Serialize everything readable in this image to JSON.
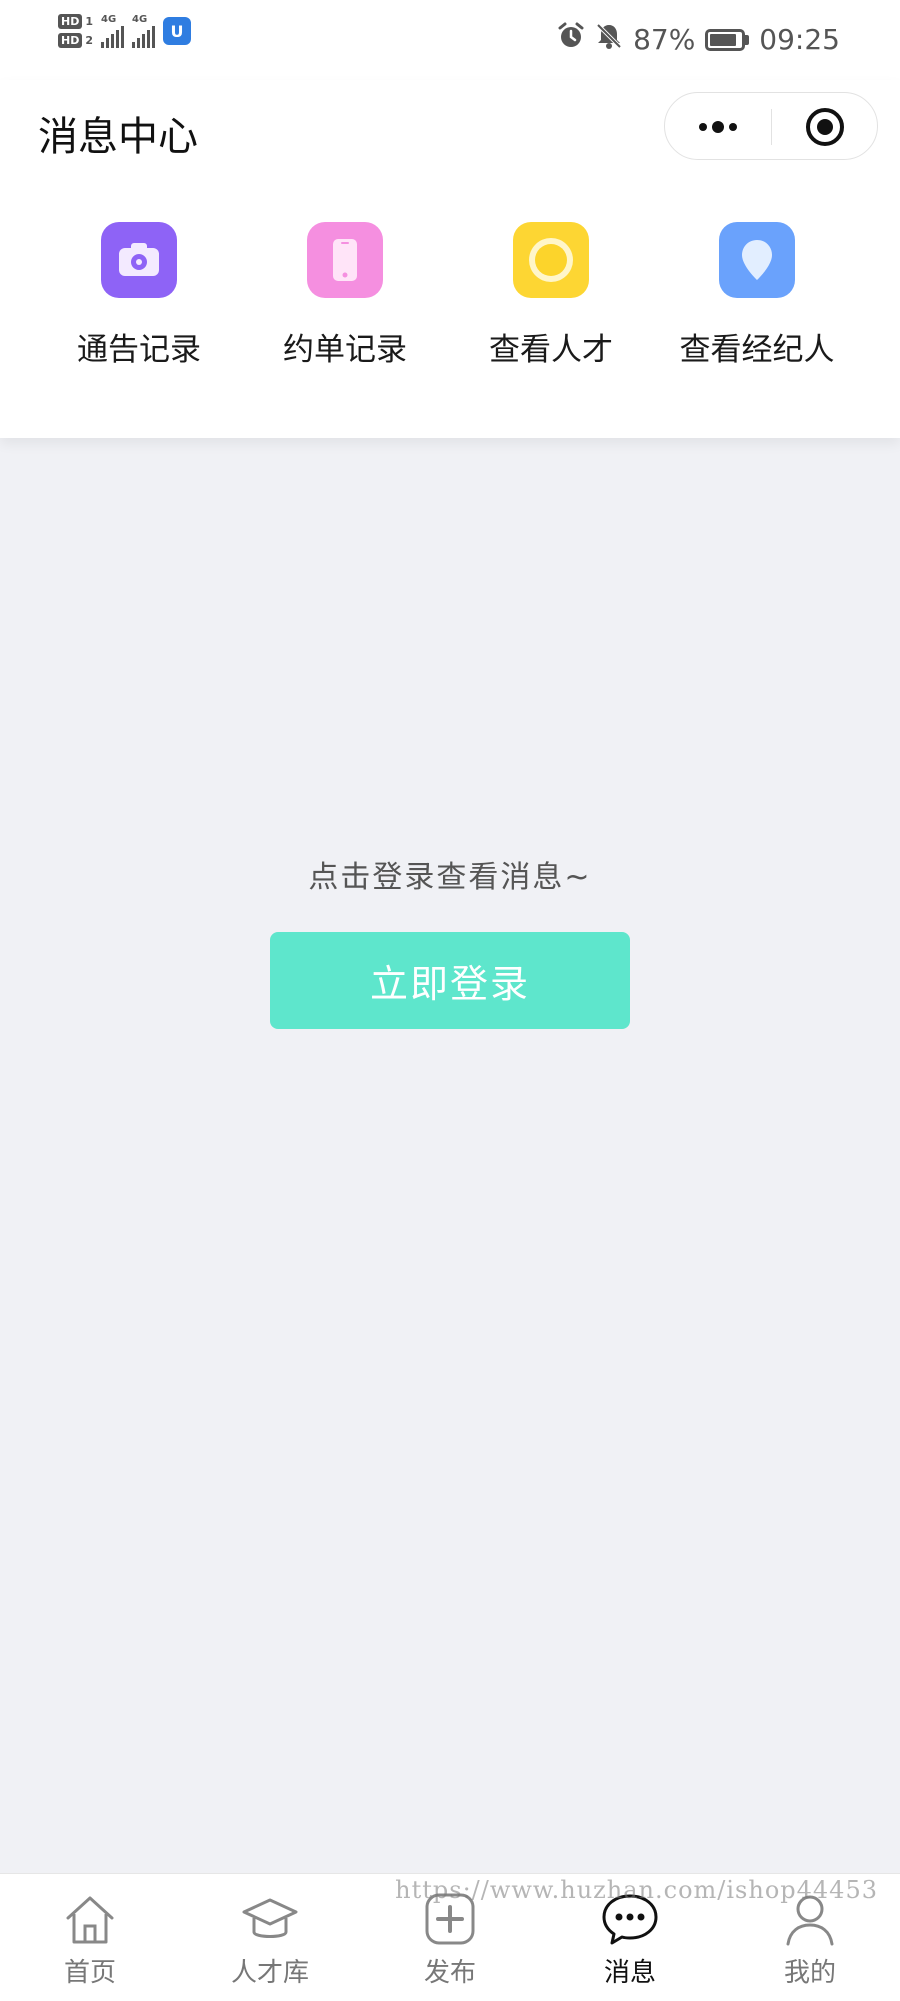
{
  "status_bar": {
    "sim1": "HD",
    "sim1_num": "1",
    "sim2": "HD",
    "sim2_num": "2",
    "network1": "4G",
    "network2": "4G",
    "app_badge": "U",
    "battery_percent": "87%",
    "battery_level": 0.87,
    "time": "09:25",
    "icons": [
      "alarm-icon",
      "mute-bell-icon",
      "battery-icon"
    ]
  },
  "header": {
    "title": "消息中心",
    "capsule": [
      "more-icon",
      "close-miniprogram-icon"
    ]
  },
  "quick_actions": [
    {
      "label": "通告记录",
      "icon": "camera-icon",
      "color": "#8e63f6"
    },
    {
      "label": "约单记录",
      "icon": "phone-icon",
      "color": "#f58fe0"
    },
    {
      "label": "查看人才",
      "icon": "ring-icon",
      "color": "#fdd633"
    },
    {
      "label": "查看经纪人",
      "icon": "location-pin-icon",
      "color": "#6aa2fc"
    }
  ],
  "empty_state": {
    "hint": "点击登录查看消息~",
    "login_button": "立即登录",
    "button_color": "#5ee6cc"
  },
  "tab_bar": {
    "active": "消息",
    "items": [
      {
        "label": "首页",
        "icon": "home-icon"
      },
      {
        "label": "人才库",
        "icon": "graduation-cap-icon"
      },
      {
        "label": "发布",
        "icon": "plus-box-icon"
      },
      {
        "label": "消息",
        "icon": "chat-bubble-icon"
      },
      {
        "label": "我的",
        "icon": "user-icon"
      }
    ]
  },
  "watermark": "https://www.huzhan.com/ishop44453"
}
